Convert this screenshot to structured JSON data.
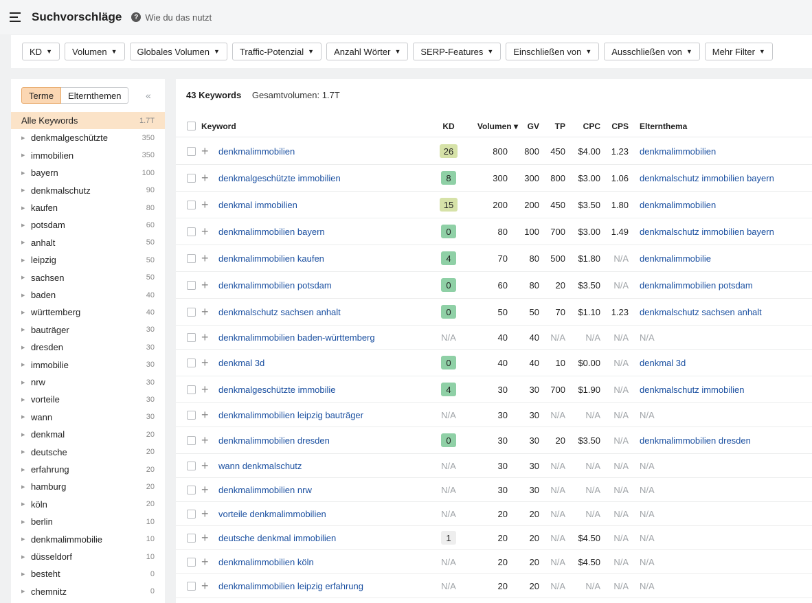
{
  "header": {
    "title": "Suchvorschläge",
    "help_icon": "question-circle-icon",
    "help_text": "Wie du das nutzt"
  },
  "filters": [
    {
      "label": "KD"
    },
    {
      "label": "Volumen"
    },
    {
      "label": "Globales Volumen"
    },
    {
      "label": "Traffic-Potenzial"
    },
    {
      "label": "Anzahl Wörter"
    },
    {
      "label": "SERP-Features"
    },
    {
      "label": "Einschließen von"
    },
    {
      "label": "Ausschließen von"
    },
    {
      "label": "Mehr Filter"
    }
  ],
  "sidebar": {
    "tabs": [
      "Terme",
      "Elternthemen"
    ],
    "active_tab": "Terme",
    "collapse_icon": "double-chevron-left-icon",
    "items": [
      {
        "label": "Alle Keywords",
        "count": "1.7T",
        "active": true
      },
      {
        "label": "denkmalgeschützte",
        "count": "350"
      },
      {
        "label": "immobilien",
        "count": "350"
      },
      {
        "label": "bayern",
        "count": "100"
      },
      {
        "label": "denkmalschutz",
        "count": "90"
      },
      {
        "label": "kaufen",
        "count": "80"
      },
      {
        "label": "potsdam",
        "count": "60"
      },
      {
        "label": "anhalt",
        "count": "50"
      },
      {
        "label": "leipzig",
        "count": "50"
      },
      {
        "label": "sachsen",
        "count": "50"
      },
      {
        "label": "baden",
        "count": "40"
      },
      {
        "label": "württemberg",
        "count": "40"
      },
      {
        "label": "bauträger",
        "count": "30"
      },
      {
        "label": "dresden",
        "count": "30"
      },
      {
        "label": "immobilie",
        "count": "30"
      },
      {
        "label": "nrw",
        "count": "30"
      },
      {
        "label": "vorteile",
        "count": "30"
      },
      {
        "label": "wann",
        "count": "30"
      },
      {
        "label": "denkmal",
        "count": "20"
      },
      {
        "label": "deutsche",
        "count": "20"
      },
      {
        "label": "erfahrung",
        "count": "20"
      },
      {
        "label": "hamburg",
        "count": "20"
      },
      {
        "label": "köln",
        "count": "20"
      },
      {
        "label": "berlin",
        "count": "10"
      },
      {
        "label": "denkmalimmobilie",
        "count": "10"
      },
      {
        "label": "düsseldorf",
        "count": "10"
      },
      {
        "label": "besteht",
        "count": "0"
      },
      {
        "label": "chemnitz",
        "count": "0"
      }
    ]
  },
  "main": {
    "keywords_count": "43 Keywords",
    "total_volume": "Gesamtvolumen: 1.7T",
    "columns": [
      "Keyword",
      "KD",
      "Volumen ▾",
      "GV",
      "TP",
      "CPC",
      "CPS",
      "Elternthema"
    ],
    "kd_colors": {
      "light_olive": "#d6e2a8",
      "green": "#8fd0a6",
      "gray": "#eeeeee"
    },
    "rows": [
      {
        "keyword": "denkmalimmobilien",
        "kd": "26",
        "vol": "800",
        "gv": "800",
        "tp": "450",
        "cpc": "$4.00",
        "cps": "1.23",
        "parent": "denkmalimmobilien"
      },
      {
        "keyword": "denkmalgeschützte immobilien",
        "kd": "8",
        "vol": "300",
        "gv": "300",
        "tp": "800",
        "cpc": "$3.00",
        "cps": "1.06",
        "parent": "denkmalschutz immobilien bayern"
      },
      {
        "keyword": "denkmal immobilien",
        "kd": "15",
        "vol": "200",
        "gv": "200",
        "tp": "450",
        "cpc": "$3.50",
        "cps": "1.80",
        "parent": "denkmalimmobilien"
      },
      {
        "keyword": "denkmalimmobilien bayern",
        "kd": "0",
        "vol": "80",
        "gv": "100",
        "tp": "700",
        "cpc": "$3.00",
        "cps": "1.49",
        "parent": "denkmalschutz immobilien bayern"
      },
      {
        "keyword": "denkmalimmobilien kaufen",
        "kd": "4",
        "vol": "70",
        "gv": "80",
        "tp": "500",
        "cpc": "$1.80",
        "cps": "N/A",
        "parent": "denkmalimmobilie"
      },
      {
        "keyword": "denkmalimmobilien potsdam",
        "kd": "0",
        "vol": "60",
        "gv": "80",
        "tp": "20",
        "cpc": "$3.50",
        "cps": "N/A",
        "parent": "denkmalimmobilien potsdam"
      },
      {
        "keyword": "denkmalschutz sachsen anhalt",
        "kd": "0",
        "vol": "50",
        "gv": "50",
        "tp": "70",
        "cpc": "$1.10",
        "cps": "1.23",
        "parent": "denkmalschutz sachsen anhalt"
      },
      {
        "keyword": "denkmalimmobilien baden-württemberg",
        "kd": "N/A",
        "vol": "40",
        "gv": "40",
        "tp": "N/A",
        "cpc": "N/A",
        "cps": "N/A",
        "parent": "N/A"
      },
      {
        "keyword": "denkmal 3d",
        "kd": "0",
        "vol": "40",
        "gv": "40",
        "tp": "10",
        "cpc": "$0.00",
        "cps": "N/A",
        "parent": "denkmal 3d"
      },
      {
        "keyword": "denkmalgeschützte immobilie",
        "kd": "4",
        "vol": "30",
        "gv": "30",
        "tp": "700",
        "cpc": "$1.90",
        "cps": "N/A",
        "parent": "denkmalschutz immobilien"
      },
      {
        "keyword": "denkmalimmobilien leipzig bauträger",
        "kd": "N/A",
        "vol": "30",
        "gv": "30",
        "tp": "N/A",
        "cpc": "N/A",
        "cps": "N/A",
        "parent": "N/A"
      },
      {
        "keyword": "denkmalimmobilien dresden",
        "kd": "0",
        "vol": "30",
        "gv": "30",
        "tp": "20",
        "cpc": "$3.50",
        "cps": "N/A",
        "parent": "denkmalimmobilien dresden"
      },
      {
        "keyword": "wann denkmalschutz",
        "kd": "N/A",
        "vol": "30",
        "gv": "30",
        "tp": "N/A",
        "cpc": "N/A",
        "cps": "N/A",
        "parent": "N/A"
      },
      {
        "keyword": "denkmalimmobilien nrw",
        "kd": "N/A",
        "vol": "30",
        "gv": "30",
        "tp": "N/A",
        "cpc": "N/A",
        "cps": "N/A",
        "parent": "N/A"
      },
      {
        "keyword": "vorteile denkmalimmobilien",
        "kd": "N/A",
        "vol": "20",
        "gv": "20",
        "tp": "N/A",
        "cpc": "N/A",
        "cps": "N/A",
        "parent": "N/A"
      },
      {
        "keyword": "deutsche denkmal immobilien",
        "kd": "1",
        "vol": "20",
        "gv": "20",
        "tp": "N/A",
        "cpc": "$4.50",
        "cps": "N/A",
        "parent": "N/A"
      },
      {
        "keyword": "denkmalimmobilien köln",
        "kd": "N/A",
        "vol": "20",
        "gv": "20",
        "tp": "N/A",
        "cpc": "$4.50",
        "cps": "N/A",
        "parent": "N/A"
      },
      {
        "keyword": "denkmalimmobilien leipzig erfahrung",
        "kd": "N/A",
        "vol": "20",
        "gv": "20",
        "tp": "N/A",
        "cpc": "N/A",
        "cps": "N/A",
        "parent": "N/A"
      }
    ]
  }
}
